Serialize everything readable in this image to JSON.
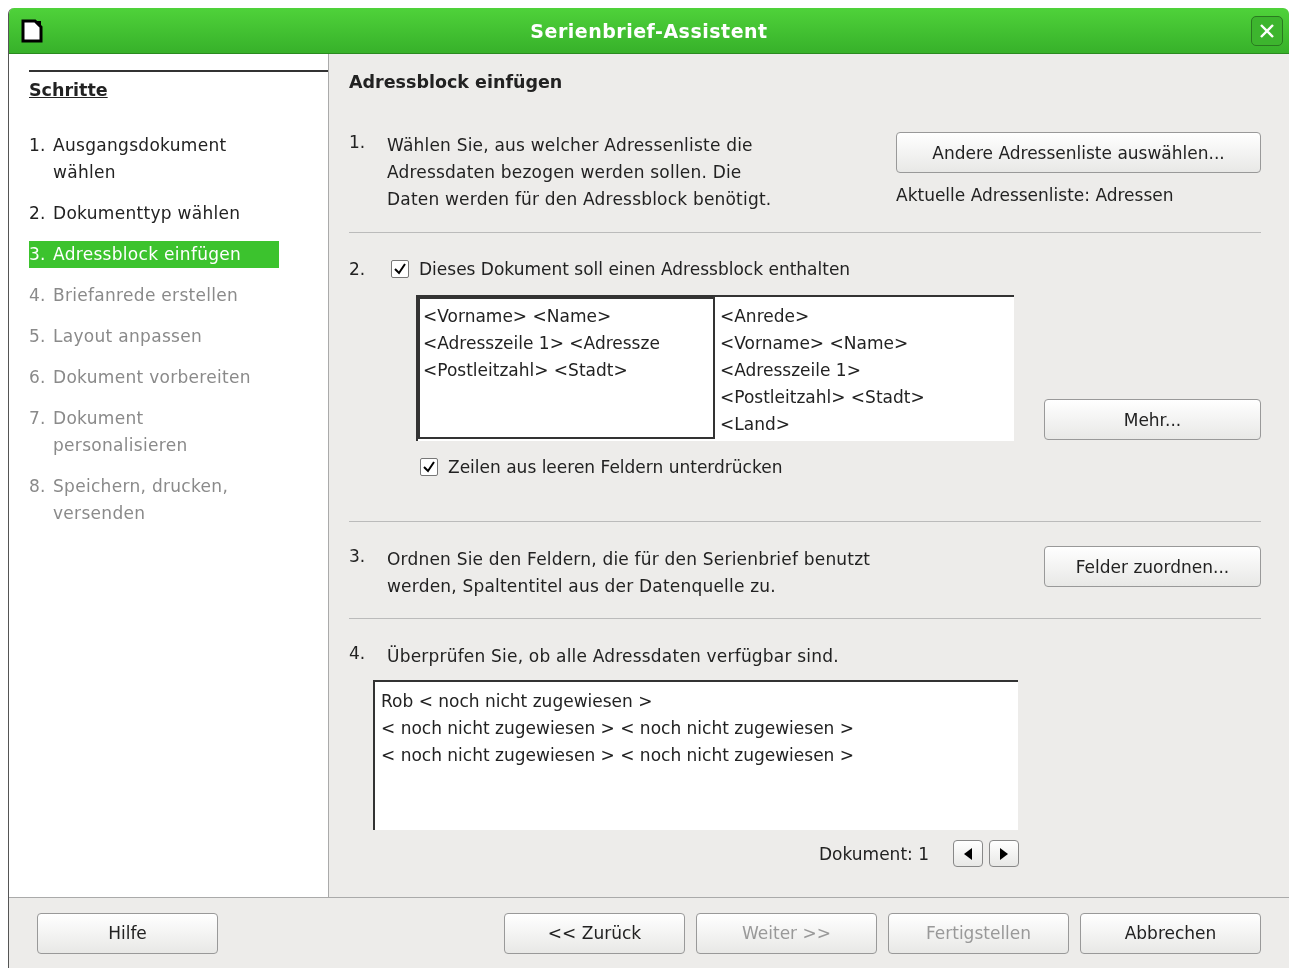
{
  "window": {
    "title": "Serienbrief-Assistent"
  },
  "sidebar": {
    "title": "Schritte",
    "steps": [
      {
        "number": "1.",
        "label": "Ausgangsdokument wählen",
        "selected": false,
        "disabled": false
      },
      {
        "number": "2.",
        "label": "Dokumenttyp wählen",
        "selected": false,
        "disabled": false
      },
      {
        "number": "3.",
        "label": "Adressblock einfügen",
        "selected": true,
        "disabled": false
      },
      {
        "number": "4.",
        "label": "Briefanrede erstellen",
        "selected": false,
        "disabled": true
      },
      {
        "number": "5.",
        "label": "Layout anpassen",
        "selected": false,
        "disabled": true
      },
      {
        "number": "6.",
        "label": "Dokument vorbereiten",
        "selected": false,
        "disabled": true
      },
      {
        "number": "7.",
        "label": "Dokument personalisieren",
        "selected": false,
        "disabled": true
      },
      {
        "number": "8.",
        "label": "Speichern, drucken, versenden",
        "selected": false,
        "disabled": true
      }
    ]
  },
  "heading": "Adressblock einfügen",
  "section_1": {
    "number": "1.",
    "text": "Wählen Sie, aus welcher Adressenliste die Adressdaten bezogen werden sollen. Die Daten werden für den Adressblock benötigt.",
    "button": "Andere Adressenliste auswählen...",
    "current_list": "Aktuelle Adressenliste: Adressen"
  },
  "section_2": {
    "number": "2.",
    "checkbox": {
      "label": "Dieses Dokument soll einen Adressblock enthalten",
      "checked": true
    },
    "layouts": [
      {
        "selected": true,
        "lines": [
          "<Vorname> <Name>",
          "<Adresszeile 1> <Adressze",
          "<Postleitzahl> <Stadt>"
        ]
      },
      {
        "selected": false,
        "lines": [
          "<Anrede>",
          "<Vorname> <Name>",
          "<Adresszeile 1>",
          "<Postleitzahl> <Stadt>",
          "<Land>"
        ]
      }
    ],
    "more_button": "Mehr...",
    "suppress_checkbox": {
      "label": "Zeilen aus leeren Feldern unterdrücken",
      "checked": true
    }
  },
  "section_3": {
    "number": "3.",
    "text": "Ordnen Sie den Feldern, die für den Serienbrief benutzt werden, Spaltentitel aus der Datenquelle zu.",
    "button": "Felder zuordnen..."
  },
  "section_4": {
    "number": "4.",
    "text": "Überprüfen Sie, ob alle Adressdaten verfügbar sind.",
    "preview_lines": [
      "Rob < noch nicht zugewiesen >",
      "< noch nicht zugewiesen > < noch nicht zugewiesen >",
      "< noch nicht zugewiesen > < noch nicht zugewiesen >"
    ],
    "document_label": "Dokument: 1"
  },
  "buttons": [
    {
      "label": "Hilfe",
      "disabled": false
    },
    {
      "label": "<< Zurück",
      "disabled": false
    },
    {
      "label": "Weiter >>",
      "disabled": true
    },
    {
      "label": "Fertigstellen",
      "disabled": true
    },
    {
      "label": "Abbrechen",
      "disabled": false
    }
  ]
}
